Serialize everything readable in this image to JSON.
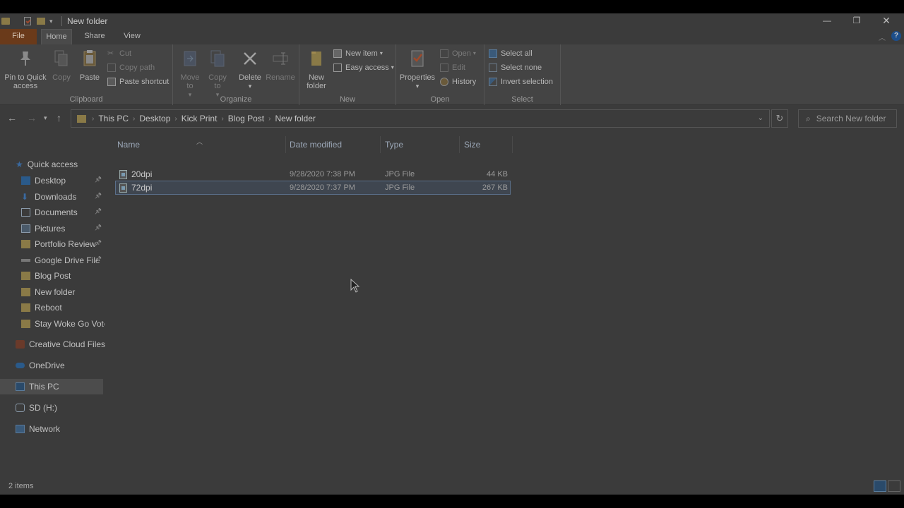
{
  "window": {
    "title": "New folder"
  },
  "ribbon_tabs": [
    "File",
    "Home",
    "Share",
    "View"
  ],
  "clipboard": {
    "label": "Clipboard",
    "pin": "Pin to Quick access",
    "copy": "Copy",
    "paste": "Paste",
    "cut": "Cut",
    "copy_path": "Copy path",
    "paste_shortcut": "Paste shortcut"
  },
  "organize": {
    "label": "Organize",
    "move_to": "Move to",
    "copy_to": "Copy to",
    "delete": "Delete",
    "rename": "Rename"
  },
  "new_group": {
    "label": "New",
    "new_folder": "New folder",
    "new_item": "New item",
    "easy_access": "Easy access"
  },
  "open_group": {
    "label": "Open",
    "properties": "Properties",
    "open": "Open",
    "edit": "Edit",
    "history": "History"
  },
  "select_group": {
    "label": "Select",
    "select_all": "Select all",
    "select_none": "Select none",
    "invert": "Invert selection"
  },
  "breadcrumb": [
    "This PC",
    "Desktop",
    "Kick Print",
    "Blog Post",
    "New folder"
  ],
  "search": {
    "placeholder": "Search New folder"
  },
  "nav": {
    "quick_access": "Quick access",
    "items": [
      {
        "label": "Desktop",
        "icon": "desktop-icon",
        "pinned": true
      },
      {
        "label": "Downloads",
        "icon": "download-icon",
        "pinned": true
      },
      {
        "label": "Documents",
        "icon": "document-icon",
        "pinned": true
      },
      {
        "label": "Pictures",
        "icon": "pictures-icon",
        "pinned": true
      },
      {
        "label": "Portfolio Review",
        "icon": "folder-icon",
        "pinned": true
      },
      {
        "label": "Google Drive File",
        "icon": "drive-icon",
        "pinned": true
      },
      {
        "label": "Blog Post",
        "icon": "folder-icon",
        "pinned": false
      },
      {
        "label": "New folder",
        "icon": "folder-icon",
        "pinned": false
      },
      {
        "label": "Reboot",
        "icon": "folder-icon",
        "pinned": false
      },
      {
        "label": "Stay Woke Go Vote_",
        "icon": "folder-icon",
        "pinned": false
      }
    ],
    "creative_cloud": "Creative Cloud Files",
    "onedrive": "OneDrive",
    "this_pc": "This PC",
    "sd": "SD (H:)",
    "network": "Network"
  },
  "columns": {
    "name": "Name",
    "date": "Date modified",
    "type": "Type",
    "size": "Size"
  },
  "files": [
    {
      "name": "20dpi",
      "date": "9/28/2020 7:38 PM",
      "type": "JPG File",
      "size": "44 KB"
    },
    {
      "name": "72dpi",
      "date": "9/28/2020 7:37 PM",
      "type": "JPG File",
      "size": "267 KB"
    }
  ],
  "status": {
    "item_count": "2 items"
  }
}
